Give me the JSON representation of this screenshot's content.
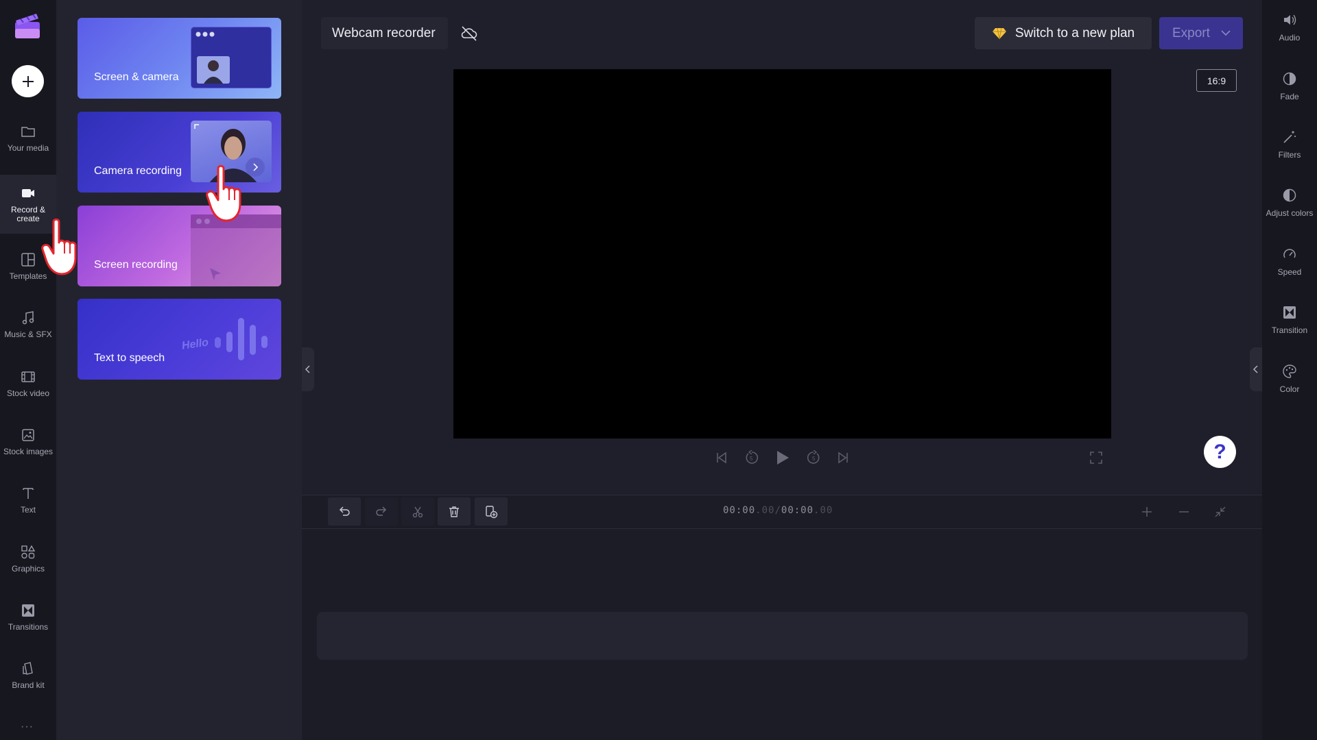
{
  "app": {
    "project_title": "Webcam recorder",
    "plan_button_label": "Switch to a new plan",
    "export_button_label": "Export",
    "aspect_ratio": "16:9",
    "help_label": "?"
  },
  "left_nav": {
    "items": [
      {
        "label": "Your media",
        "icon": "folder-icon"
      },
      {
        "label": "Record &\ncreate",
        "icon": "video-camera-icon",
        "active": true
      },
      {
        "label": "Templates",
        "icon": "templates-icon"
      },
      {
        "label": "Music & SFX",
        "icon": "music-note-icon"
      },
      {
        "label": "Stock video",
        "icon": "film-icon"
      },
      {
        "label": "Stock images",
        "icon": "image-icon"
      },
      {
        "label": "Text",
        "icon": "text-icon"
      },
      {
        "label": "Graphics",
        "icon": "shapes-icon"
      },
      {
        "label": "Transitions",
        "icon": "transition-icon"
      },
      {
        "label": "Brand kit",
        "icon": "brand-kit-icon"
      }
    ],
    "more_label": "···"
  },
  "panel": {
    "cards": [
      {
        "label": "Screen & camera"
      },
      {
        "label": "Camera recording"
      },
      {
        "label": "Screen recording"
      },
      {
        "label": "Text to speech",
        "art_text": "Hello"
      }
    ]
  },
  "right_panel": {
    "items": [
      {
        "label": "Audio",
        "icon": "speaker-icon"
      },
      {
        "label": "Fade",
        "icon": "fade-icon"
      },
      {
        "label": "Filters",
        "icon": "magic-wand-icon"
      },
      {
        "label": "Adjust colors",
        "icon": "contrast-icon"
      },
      {
        "label": "Speed",
        "icon": "speedometer-icon"
      },
      {
        "label": "Transition",
        "icon": "transition-icon"
      },
      {
        "label": "Color",
        "icon": "palette-icon"
      }
    ]
  },
  "timeline": {
    "current_time": "00:00",
    "current_frac": ".00",
    "separator": "/",
    "total_time": "00:00",
    "total_frac": ".00"
  },
  "colors": {
    "accent": "#3c34c8",
    "nav_bg": "#17171f",
    "panel_bg": "#23232f",
    "stage_bg": "#1f1f2b",
    "pointer_red": "#e3262e"
  }
}
